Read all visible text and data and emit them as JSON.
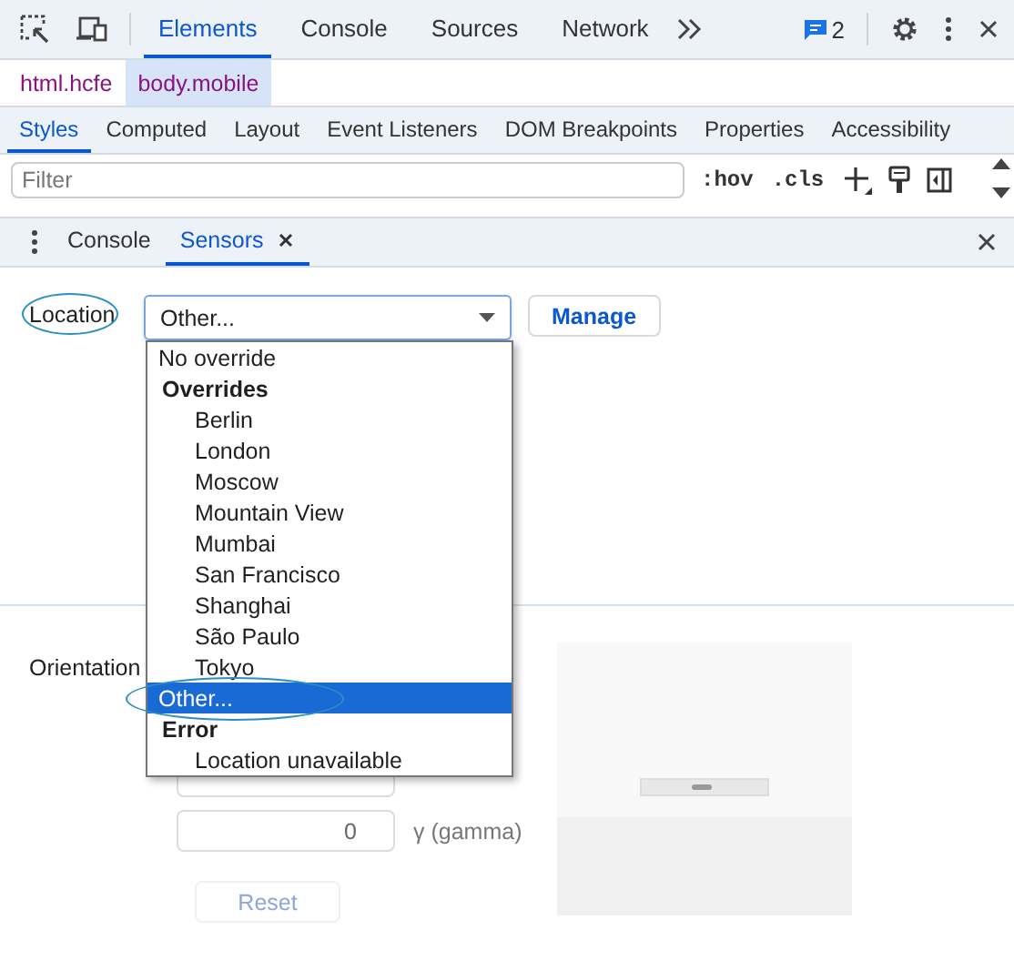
{
  "top_toolbar": {
    "tabs": [
      {
        "label": "Elements",
        "selected": true
      },
      {
        "label": "Console",
        "selected": false
      },
      {
        "label": "Sources",
        "selected": false
      },
      {
        "label": "Network",
        "selected": false
      }
    ],
    "issues_count": "2"
  },
  "breadcrumbs": [
    {
      "label": "html.hcfe",
      "selected": false
    },
    {
      "label": "body.mobile",
      "selected": true
    }
  ],
  "style_tabs": [
    {
      "label": "Styles",
      "selected": true
    },
    {
      "label": "Computed",
      "selected": false
    },
    {
      "label": "Layout",
      "selected": false
    },
    {
      "label": "Event Listeners",
      "selected": false
    },
    {
      "label": "DOM Breakpoints",
      "selected": false
    },
    {
      "label": "Properties",
      "selected": false
    },
    {
      "label": "Accessibility",
      "selected": false
    }
  ],
  "filter": {
    "placeholder": "Filter",
    "buttons": [
      ":hov",
      ".cls"
    ]
  },
  "drawer_tabs": [
    {
      "label": "Console",
      "selected": false,
      "closable": false
    },
    {
      "label": "Sensors",
      "selected": true,
      "closable": true
    }
  ],
  "location": {
    "label": "Location",
    "circled": true,
    "value": "Other...",
    "manage_button": "Manage",
    "options": [
      {
        "kind": "option",
        "label": "No override",
        "selected": false,
        "circled": false
      },
      {
        "kind": "group",
        "label": "Overrides"
      },
      {
        "kind": "suboption",
        "label": "Berlin",
        "selected": false,
        "circled": false
      },
      {
        "kind": "suboption",
        "label": "London",
        "selected": false,
        "circled": false
      },
      {
        "kind": "suboption",
        "label": "Moscow",
        "selected": false,
        "circled": false
      },
      {
        "kind": "suboption",
        "label": "Mountain View",
        "selected": false,
        "circled": false
      },
      {
        "kind": "suboption",
        "label": "Mumbai",
        "selected": false,
        "circled": false
      },
      {
        "kind": "suboption",
        "label": "San Francisco",
        "selected": false,
        "circled": false
      },
      {
        "kind": "suboption",
        "label": "Shanghai",
        "selected": false,
        "circled": false
      },
      {
        "kind": "suboption",
        "label": "São Paulo",
        "selected": false,
        "circled": false
      },
      {
        "kind": "suboption",
        "label": "Tokyo",
        "selected": false,
        "circled": false
      },
      {
        "kind": "option",
        "label": "Other...",
        "selected": true,
        "circled": true
      },
      {
        "kind": "group",
        "label": "Error"
      },
      {
        "kind": "suboption",
        "label": "Location unavailable",
        "selected": false,
        "circled": false
      }
    ]
  },
  "orientation": {
    "label": "Orientation",
    "fields": [
      {
        "covered": true
      },
      {
        "covered": false,
        "value": "0",
        "label": "γ (gamma)"
      }
    ],
    "reset_button": {
      "label": "Reset",
      "disabled": true
    }
  }
}
